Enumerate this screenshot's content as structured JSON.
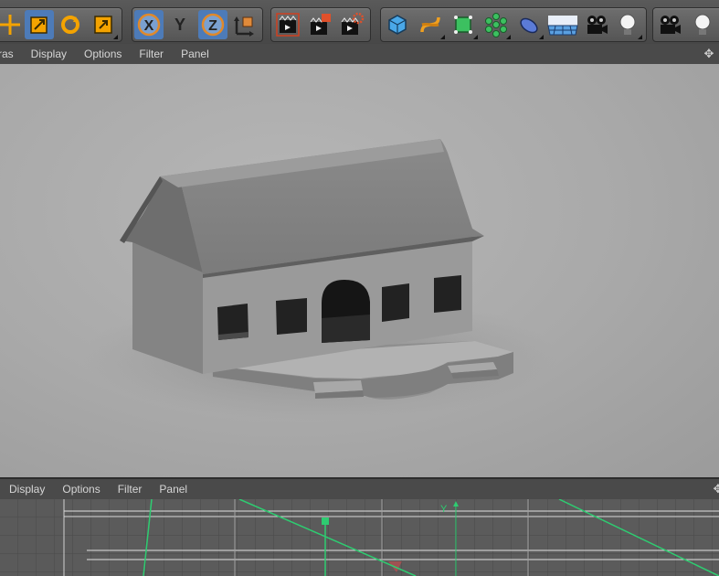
{
  "toolbar": {
    "axis_x": "X",
    "axis_y": "Y",
    "axis_z": "Z"
  },
  "viewport_menu": [
    "ras",
    "Display",
    "Options",
    "Filter",
    "Panel"
  ],
  "graph_menu": [
    "Display",
    "Options",
    "Filter",
    "Panel"
  ],
  "graph": {
    "axis_label": "Y"
  },
  "colors": {
    "accent_blue": "#4d7bb8",
    "viewport_bg": "#aaaaaa",
    "graph_line": "#2ecc71"
  },
  "icons": [
    "move-icon",
    "scale-icon",
    "rotate-icon",
    "recent-tool-icon",
    "x-axis-lock-icon",
    "y-axis-lock-icon",
    "z-axis-lock-icon",
    "coordinate-system-icon",
    "render-view-icon",
    "render-picture-viewer-icon",
    "render-settings-icon",
    "cube-icon",
    "spline-icon",
    "subdivision-icon",
    "cloner-icon",
    "deformer-icon",
    "floor-icon",
    "camera-icon",
    "light-icon",
    "camera-icon-2",
    "light-icon-2"
  ]
}
